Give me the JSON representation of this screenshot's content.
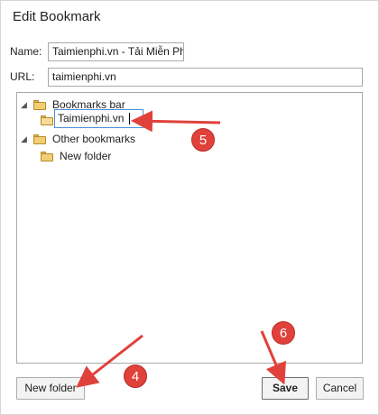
{
  "dialog": {
    "title": "Edit Bookmark",
    "name_label": "Name:",
    "name_value": "Taimienphi.vn - Tải Miễn Phí",
    "url_label": "URL:",
    "url_value": "taimienphi.vn"
  },
  "tree": {
    "items": [
      {
        "label": "Bookmarks bar",
        "expanded": true
      },
      {
        "label": "Taimienphi.vn",
        "editing": true
      },
      {
        "label": "Other bookmarks",
        "expanded": true
      },
      {
        "label": "New folder"
      }
    ]
  },
  "buttons": {
    "new_folder": "New folder",
    "save": "Save",
    "cancel": "Cancel"
  },
  "annotations": {
    "step_4": "4",
    "step_5": "5",
    "step_6": "6",
    "color": "#e0413a"
  },
  "colors": {
    "folder": "#f2cd73",
    "focus_border": "#4a90d9"
  }
}
